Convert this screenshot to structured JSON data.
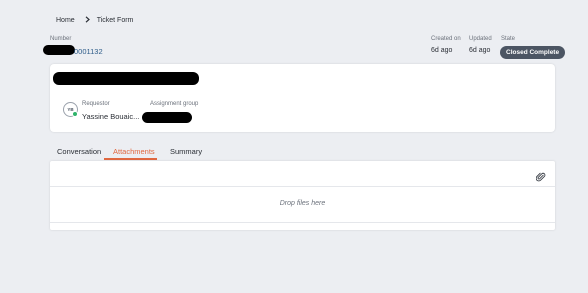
{
  "breadcrumb": {
    "home": "Home",
    "separator": "›",
    "current": "Ticket Form"
  },
  "header": {
    "number_label": "Number",
    "number_value_visible": "0001132",
    "created_label": "Created on",
    "created_value": "6d ago",
    "updated_label": "Updated",
    "updated_value": "6d ago",
    "state_label": "State",
    "state_value": "Closed Complete"
  },
  "summary_card": {
    "requestor_label": "Requestor",
    "requestor_value": "Yassine Bouaic...",
    "requestor_initials": "YB",
    "assignment_label": "Assignment group"
  },
  "tabs": [
    {
      "label": "Conversation",
      "active": false
    },
    {
      "label": "Attachments",
      "active": true
    },
    {
      "label": "Summary",
      "active": false
    }
  ],
  "attachments": {
    "drop_text": "Drop files here",
    "attach_icon": "paperclip-icon"
  },
  "colors": {
    "accent": "#e06840",
    "badge": "#4c5563",
    "online": "#2fb36a",
    "background": "#eceef2"
  }
}
